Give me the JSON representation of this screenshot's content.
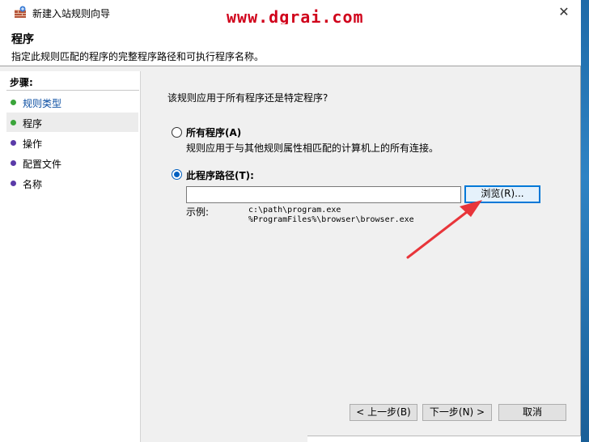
{
  "window": {
    "title": "新建入站规则向导",
    "watermark": "www.dgrai.com",
    "close_glyph": "✕"
  },
  "header": {
    "title": "程序",
    "description": "指定此规则匹配的程序的完整程序路径和可执行程序名称。"
  },
  "sidebar": {
    "title": "步骤:",
    "items": [
      {
        "label": "规则类型",
        "state": "done"
      },
      {
        "label": "程序",
        "state": "current"
      },
      {
        "label": "操作",
        "state": "pending"
      },
      {
        "label": "配置文件",
        "state": "pending"
      },
      {
        "label": "名称",
        "state": "pending"
      }
    ]
  },
  "main": {
    "question": "该规则应用于所有程序还是特定程序?",
    "option_all": {
      "label": "所有程序(A)",
      "description": "规则应用于与其他规则属性相匹配的计算机上的所有连接。",
      "selected": false
    },
    "option_path": {
      "label": "此程序路径(T):",
      "selected": true,
      "value": ""
    },
    "browse_label": "浏览(R)...",
    "example_label": "示例:",
    "example_lines": "c:\\path\\program.exe\n%ProgramFiles%\\browser\\browser.exe"
  },
  "footer": {
    "back_label": "< 上一步(B)",
    "next_label": "下一步(N) >",
    "cancel_label": "取消"
  },
  "colors": {
    "accent": "#0078d7",
    "arrow": "#e8353a",
    "done_dot": "#3aa53a",
    "pending_dot": "#5a3aa8"
  }
}
